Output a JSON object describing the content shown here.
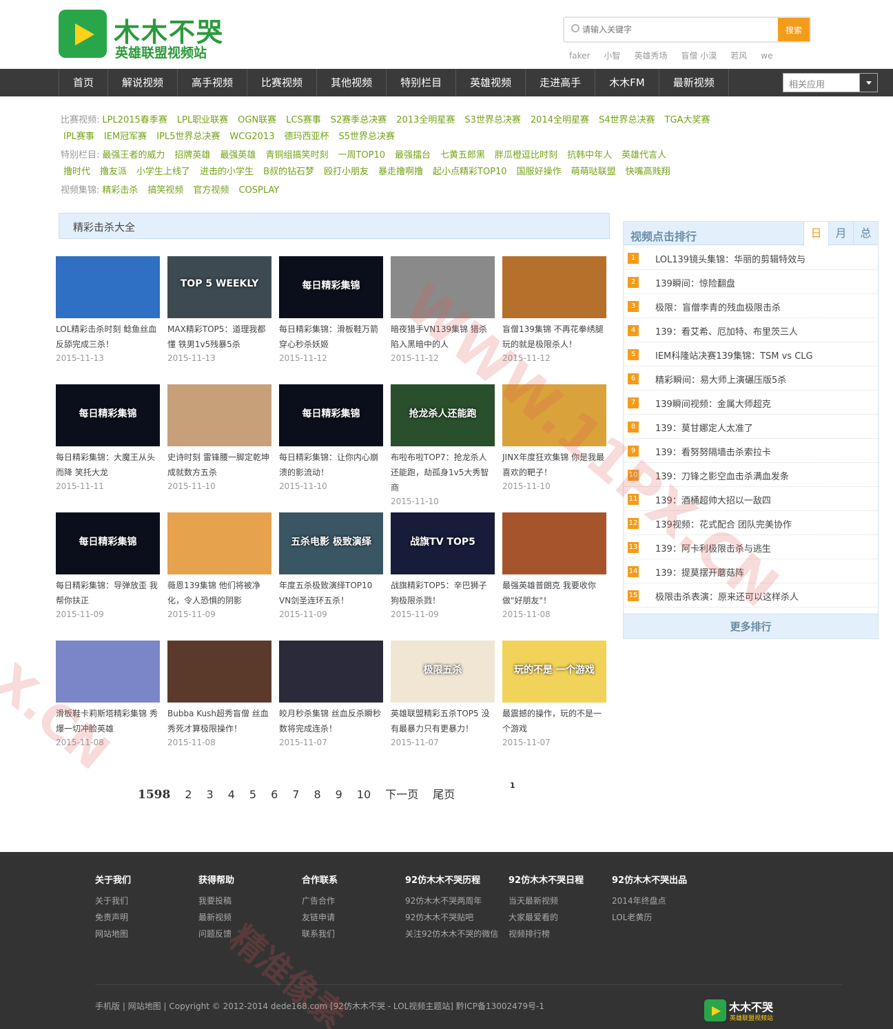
{
  "header": {
    "logo_title": "木木不哭",
    "logo_subtitle": "英雄联盟视频站",
    "search": {
      "placeholder": "请输入关键字",
      "button": "搜索"
    },
    "hotwords": [
      "faker",
      "小智",
      "英雄秀场",
      "盲僧 小漠",
      "若风",
      "we"
    ]
  },
  "nav": {
    "items": [
      "首页",
      "解说视频",
      "高手视频",
      "比赛视频",
      "其他视频",
      "特别栏目",
      "英雄视频",
      "走进高手",
      "木木FM",
      "最新视频"
    ],
    "select_label": "相关应用"
  },
  "tags": {
    "match_label": "比赛视频:",
    "match_row1": [
      "LPL2015春季赛",
      "LPL职业联赛",
      "OGN联赛",
      "LCS赛事",
      "S2赛季总决赛",
      "2013全明星赛",
      "S3世界总决赛",
      "2014全明星赛",
      "S4世界总决赛",
      "TGA大奖赛"
    ],
    "match_row2": [
      "IPL赛事",
      "IEM冠军赛",
      "IPL5世界总决赛",
      "WCG2013",
      "德玛西亚杯",
      "S5世界总决赛"
    ],
    "special_label": "特别栏目:",
    "special_row1": [
      "最强王者的威力",
      "招牌英雄",
      "最强英雄",
      "青铜组搞笑时刻",
      "一周TOP10",
      "最强擂台",
      "七黄五郎黑",
      "胖瓜橙逗比时刻",
      "抗韩中年人",
      "英雄代言人"
    ],
    "special_row2": [
      "撸时代",
      "撸友派",
      "小学生上线了",
      "进击的小学生",
      "B叔的钻石梦",
      "殴打小朋友",
      "暴走撸啊撸",
      "起小点精彩TOP10",
      "国服好操作",
      "萌萌哒联盟",
      "快嘴高贱翔"
    ],
    "collection_label": "视频集锦:",
    "collection_row": [
      "精彩击杀",
      "搞笑视频",
      "官方视频",
      "COSPLAY"
    ]
  },
  "section": {
    "title": "精彩击杀大全"
  },
  "videos": [
    {
      "title": "LOL精彩击杀时刻 鲶鱼丝血反舔完成三杀！",
      "date": "2015-11-13",
      "thumb": "",
      "color": "#2f6fc4"
    },
    {
      "title": "MAX精彩TOP5：道理我都懂 铁男1v5残暴5杀",
      "date": "2015-11-13",
      "thumb": "TOP 5 WEEKLY",
      "color": "#3e4a52"
    },
    {
      "title": "每日精彩集锦：滑板鞋万箭穿心秒杀妖姬",
      "date": "2015-11-12",
      "thumb": "每日精彩集锦",
      "color": "#0b0f1c"
    },
    {
      "title": "暗夜猎手VN139集锦 猎杀陷入黑暗中的人",
      "date": "2015-11-12",
      "thumb": "",
      "color": "#8a8a8a"
    },
    {
      "title": "盲僧139集锦 不再花拳绣腿玩的就是极限杀人！",
      "date": "2015-11-12",
      "thumb": "",
      "color": "#b5702c"
    },
    {
      "title": "每日精彩集锦：大魔王从头而降 笑托大龙",
      "date": "2015-11-11",
      "thumb": "每日精彩集锦",
      "color": "#0b0f1c"
    },
    {
      "title": "史诗时刻 雷锋腰一脚定乾坤成就数方五杀",
      "date": "2015-11-10",
      "thumb": "",
      "color": "#c7a07a"
    },
    {
      "title": "每日精彩集锦：让你内心崩溃的影流动！",
      "date": "2015-11-10",
      "thumb": "每日精彩集锦",
      "color": "#0b0f1c"
    },
    {
      "title": "布啦布啦TOP7：抢龙杀人还能跑，劫孤身1v5大秀智商",
      "date": "2015-11-10",
      "thumb": "抢龙杀人还能跑",
      "color": "#2a4f2c"
    },
    {
      "title": "JINX年度狂欢集锦 你是我最喜欢的靶子！",
      "date": "2015-11-10",
      "thumb": "",
      "color": "#d9a23a"
    },
    {
      "title": "每日精彩集锦：导弹放歪 我帮你扶正",
      "date": "2015-11-09",
      "thumb": "每日精彩集锦",
      "color": "#0b0f1c"
    },
    {
      "title": "薇恩139集锦 他们将被净化，令人恐惧的阴影",
      "date": "2015-11-09",
      "thumb": "",
      "color": "#e6a24d"
    },
    {
      "title": "年度五杀极致演绎TOP10 VN剑圣连环五杀！",
      "date": "2015-11-09",
      "thumb": "五杀电影 极致演绎",
      "color": "#3a5563"
    },
    {
      "title": "战旗精彩TOP5：辛巴狮子狗极限杀戮！",
      "date": "2015-11-09",
      "thumb": "战旗TV TOP5",
      "color": "#171c3a"
    },
    {
      "title": "最强英雄普朗克 我要收你做\"好朋友\"！",
      "date": "2015-11-08",
      "thumb": "",
      "color": "#a5542c"
    },
    {
      "title": "滑板鞋卡莉斯塔精彩集锦 秀爆一切冲脸英雄",
      "date": "2015-11-08",
      "thumb": "",
      "color": "#7b86c9"
    },
    {
      "title": "Bubba Kush超秀盲僧 丝血秀死才算极限操作！",
      "date": "2015-11-08",
      "thumb": "",
      "color": "#5b3a2c"
    },
    {
      "title": "皎月秒杀集锦 丝血反杀瞬秒数将完成连杀！",
      "date": "2015-11-07",
      "thumb": "",
      "color": "#2a2a3a"
    },
    {
      "title": "英雄联盟精彩五杀TOP5 没有最暴力只有更暴力！",
      "date": "2015-11-07",
      "thumb": "极限五杀",
      "color": "#f1e6d4"
    },
    {
      "title": "最震撼的操作，玩的不是一个游戏",
      "date": "2015-11-07",
      "thumb": "玩的不是 一个游戏",
      "color": "#f2d35a"
    }
  ],
  "pager": {
    "current": "1598",
    "pages": [
      "2",
      "3",
      "4",
      "5",
      "6",
      "7",
      "8",
      "9",
      "10"
    ],
    "next": "下一页",
    "last": "尾页",
    "sup": "1"
  },
  "rank": {
    "title": "视频点击排行",
    "tabs": [
      "日",
      "月",
      "总"
    ],
    "items": [
      {
        "num": "1",
        "text": "LOL139镜头集锦：华丽的剪辑特效与"
      },
      {
        "num": "2",
        "text": "139瞬间：惊险翻盘"
      },
      {
        "num": "3",
        "text": "极限：盲僧李青的残血极限击杀"
      },
      {
        "num": "4",
        "text": "139：看艾希、厄加特、布里茨三人"
      },
      {
        "num": "5",
        "text": "IEM科隆站决赛139集锦：TSM vs CLG"
      },
      {
        "num": "6",
        "text": "精彩瞬间：易大师上演碾压版5杀"
      },
      {
        "num": "7",
        "text": "139瞬间视频：金属大师超克"
      },
      {
        "num": "8",
        "text": "139：莫甘娜定人太准了"
      },
      {
        "num": "9",
        "text": "139：看努努隔墙击杀索拉卡"
      },
      {
        "num": "10",
        "text": "139：刀锋之影空血击杀满血发条"
      },
      {
        "num": "11",
        "text": "139：酒桶超帅大招以一敌四"
      },
      {
        "num": "12",
        "text": "139视频：花式配合 团队完美协作"
      },
      {
        "num": "13",
        "text": "139：阿卡利极限击杀与逃生"
      },
      {
        "num": "14",
        "text": "139：提莫摆开蘑菇阵"
      },
      {
        "num": "15",
        "text": "极限击杀表演：原来还可以这样杀人"
      }
    ],
    "more": "更多排行"
  },
  "footer": {
    "cols": [
      {
        "title": "关于我们",
        "links": [
          "关于我们",
          "免责声明",
          "网站地图"
        ]
      },
      {
        "title": "获得帮助",
        "links": [
          "我要投稿",
          "最新视频",
          "问题反馈"
        ]
      },
      {
        "title": "合作联系",
        "links": [
          "广告合作",
          "友链申请",
          "联系我们"
        ]
      },
      {
        "title": "92仿木木不哭历程",
        "links": [
          "92仿木木不哭两周年",
          "92仿木木不哭贴吧",
          "关注92仿木木不哭的微信"
        ]
      },
      {
        "title": "92仿木木不哭日程",
        "links": [
          "当天最新视频",
          "大家最爱看的",
          "视频排行榜"
        ]
      },
      {
        "title": "92仿木木不哭出品",
        "links": [
          "2014年终盘点",
          "LOL老黄历"
        ]
      }
    ],
    "copyright": "手机版 | 网站地图 | Copyright © 2012-2014 dede168.com [92仿木木不哭 - LOL视频主题站] 黔ICP备13002479号-1",
    "logo_title": "木木不哭",
    "logo_subtitle": "英雄联盟视频站"
  },
  "watermark": {
    "text1": "X.CN",
    "text2": "WWW.11PX.CN",
    "text3": "精准像素"
  }
}
